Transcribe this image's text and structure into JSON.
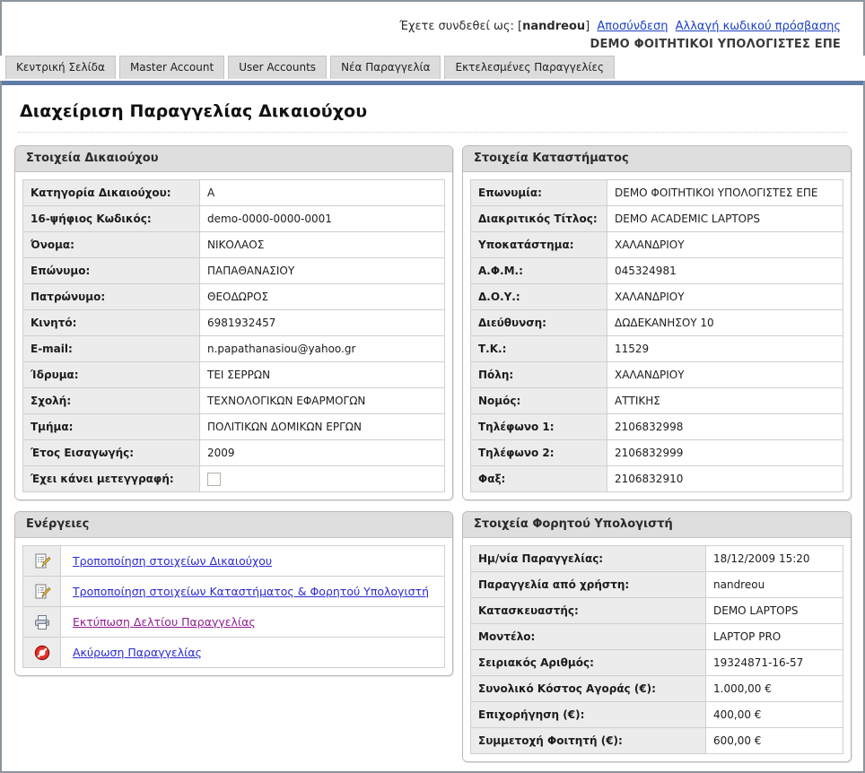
{
  "header": {
    "login_prefix": "Έχετε συνδεθεί ως: [",
    "username": "nandreou",
    "login_suffix": "]",
    "logout_link": "Αποσύνδεση",
    "change_password_link": "Αλλαγή κωδικού πρόσβασης",
    "company": "DEMO ΦΟΙΤΗΤΙΚΟΙ ΥΠΟΛΟΓΙΣΤΕΣ ΕΠΕ",
    "accent_color": "#5f7ca6",
    "link_color": "#1b3fc4"
  },
  "tabs": [
    {
      "label": "Κεντρική Σελίδα"
    },
    {
      "label": "Master Account"
    },
    {
      "label": "User Accounts"
    },
    {
      "label": "Νέα Παραγγελία"
    },
    {
      "label": "Εκτελεσμένες Παραγγελίες"
    }
  ],
  "page_title": "Διαχείριση Παραγγελίας Δικαιούχου",
  "beneficiary_panel": {
    "title": "Στοιχεία Δικαιούχου",
    "rows": [
      {
        "label": "Κατηγορία Δικαιούχου:",
        "value": "Α"
      },
      {
        "label": "16-ψήφιος Κωδικός:",
        "value": "demo-0000-0000-0001"
      },
      {
        "label": "Όνομα:",
        "value": "ΝΙΚΟΛΑΟΣ"
      },
      {
        "label": "Επώνυμο:",
        "value": "ΠΑΠΑΘΑΝΑΣΙΟΥ"
      },
      {
        "label": "Πατρώνυμο:",
        "value": "ΘΕΟΔΩΡΟΣ"
      },
      {
        "label": "Κινητό:",
        "value": "6981932457"
      },
      {
        "label": "E-mail:",
        "value": "n.papathanasiou@yahoo.gr"
      },
      {
        "label": "Ίδρυμα:",
        "value": "ΤΕΙ ΣΕΡΡΩΝ"
      },
      {
        "label": "Σχολή:",
        "value": "ΤΕΧΝΟΛΟΓΙΚΩΝ ΕΦΑΡΜΟΓΩΝ"
      },
      {
        "label": "Τμήμα:",
        "value": "ΠΟΛΙΤΙΚΩΝ ΔΟΜΙΚΩΝ ΕΡΓΩΝ"
      },
      {
        "label": "Έτος Εισαγωγής:",
        "value": "2009"
      },
      {
        "label": "Έχει κάνει μετεγγραφή:",
        "value": "",
        "checkbox": true,
        "checked": false
      }
    ]
  },
  "store_panel": {
    "title": "Στοιχεία Καταστήματος",
    "rows": [
      {
        "label": "Επωνυμία:",
        "value": "DEMO ΦΟΙΤΗΤΙΚΟΙ ΥΠΟΛΟΓΙΣΤΕΣ ΕΠΕ"
      },
      {
        "label": "Διακριτικός Τίτλος:",
        "value": "DEMO ACADEMIC LAPTOPS"
      },
      {
        "label": "Υποκατάστημα:",
        "value": "ΧΑΛΑΝΔΡΙΟΥ"
      },
      {
        "label": "Α.Φ.Μ.:",
        "value": "045324981"
      },
      {
        "label": "Δ.Ο.Υ.:",
        "value": "ΧΑΛΑΝΔΡΙΟΥ"
      },
      {
        "label": "Διεύθυνση:",
        "value": "ΔΩΔΕΚΑΝΗΣΟΥ 10"
      },
      {
        "label": "Τ.Κ.:",
        "value": "11529"
      },
      {
        "label": "Πόλη:",
        "value": "ΧΑΛΑΝΔΡΙΟΥ"
      },
      {
        "label": "Νομός:",
        "value": "ΑΤΤΙΚΗΣ"
      },
      {
        "label": "Τηλέφωνο 1:",
        "value": "2106832998"
      },
      {
        "label": "Τηλέφωνο 2:",
        "value": "2106832999"
      },
      {
        "label": "Φαξ:",
        "value": "2106832910"
      }
    ]
  },
  "actions_panel": {
    "title": "Ενέργειες",
    "items": [
      {
        "icon": "edit-document-icon",
        "label": "Τροποποίηση στοιχείων Δικαιούχου",
        "visited": false
      },
      {
        "icon": "edit-document-icon",
        "label": "Τροποποίηση στοιχείων Καταστήματος & Φορητού Υπολογιστή",
        "visited": false
      },
      {
        "icon": "printer-icon",
        "label": "Εκτύπωση Δελτίου Παραγγελίας",
        "visited": true
      },
      {
        "icon": "cancel-forbidden-icon",
        "label": "Ακύρωση Παραγγελίας",
        "visited": false
      }
    ]
  },
  "laptop_panel": {
    "title": "Στοιχεία Φορητού Υπολογιστή",
    "rows": [
      {
        "label": "Ημ/νία Παραγγελίας:",
        "value": "18/12/2009 15:20"
      },
      {
        "label": "Παραγγελία από χρήστη:",
        "value": "nandreou"
      },
      {
        "label": "Κατασκευαστής:",
        "value": "DEMO LAPTOPS"
      },
      {
        "label": "Μοντέλο:",
        "value": "LAPTOP PRO"
      },
      {
        "label": "Σειριακός Αριθμός:",
        "value": "19324871-16-57"
      },
      {
        "label": "Συνολικό Κόστος Αγοράς (€):",
        "value": "1.000,00 €"
      },
      {
        "label": "Επιχορήγηση (€):",
        "value": "400,00 €"
      },
      {
        "label": "Συμμετοχή Φοιτητή (€):",
        "value": "600,00 €"
      }
    ]
  }
}
